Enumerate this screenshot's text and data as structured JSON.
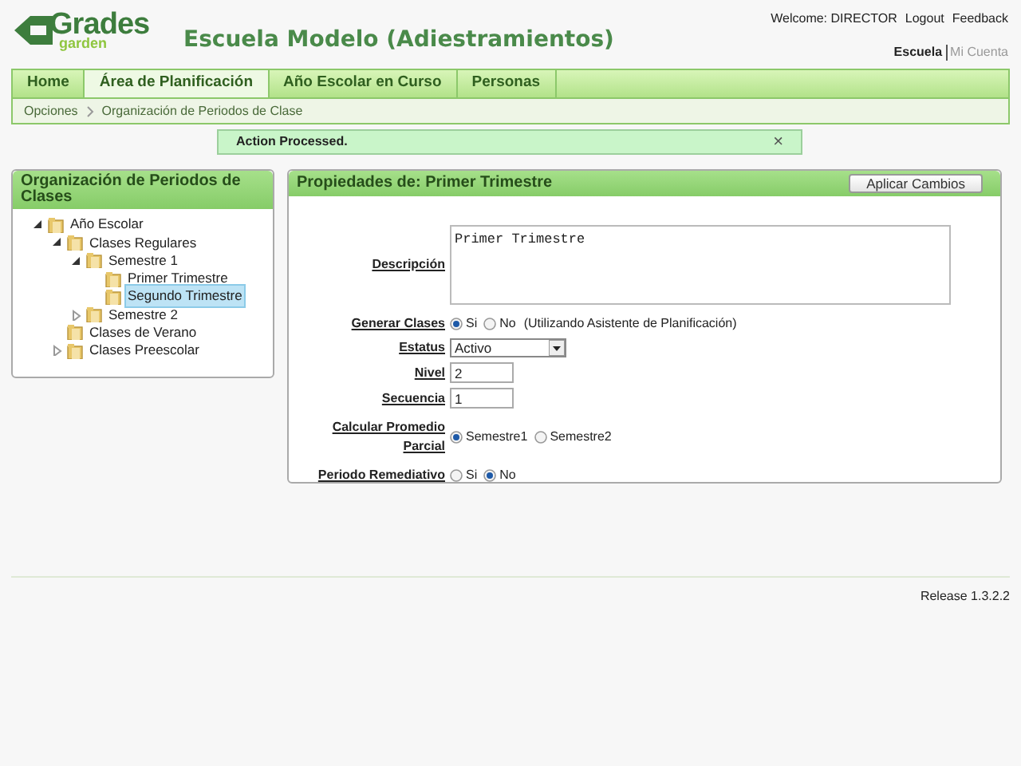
{
  "logo": {
    "line1": "Grades",
    "line2": "garden"
  },
  "school_title": "Escuela Modelo (Adiestramientos)",
  "user_bar": {
    "welcome": "Welcome: DIRECTOR",
    "links": [
      "Logout",
      "Feedback"
    ]
  },
  "context_links": [
    {
      "label": "Escuela",
      "selected": true
    },
    {
      "label": "Mi Cuenta",
      "selected": false
    }
  ],
  "tabs": [
    {
      "label": "Home",
      "selected": false
    },
    {
      "label": "Área de Planificación",
      "selected": true
    },
    {
      "label": "Año Escolar en Curso",
      "selected": false
    },
    {
      "label": "Personas",
      "selected": false
    }
  ],
  "breadcrumb": [
    "Opciones",
    "Organización de Periodos de Clase"
  ],
  "message": {
    "text": "Action Processed.",
    "close": "×"
  },
  "tree_panel": {
    "title": "Organización de Periodos de Clases",
    "items": [
      {
        "label": "Año Escolar",
        "expanded": true,
        "selected": false,
        "children": [
          {
            "label": "Clases Regulares",
            "expanded": true,
            "selected": false,
            "children": [
              {
                "label": "Semestre 1",
                "expanded": true,
                "selected": false,
                "children": [
                  {
                    "label": "Primer Trimestre",
                    "selected": false
                  },
                  {
                    "label": "Segundo Trimestre",
                    "selected": true
                  }
                ]
              },
              {
                "label": "Semestre 2",
                "expanded": false,
                "selected": false
              }
            ]
          },
          {
            "label": "Clases de Verano",
            "selected": false
          },
          {
            "label": "Clases Preescolar",
            "expanded": false,
            "selected": false
          }
        ]
      }
    ]
  },
  "properties_panel": {
    "title": "Propiedades de: Primer Trimestre",
    "apply_button": "Aplicar Cambios",
    "fields": [
      {
        "kind": "textarea",
        "label": "Descripción",
        "value": "Primer Trimestre"
      },
      {
        "kind": "radio",
        "label": "Generar Clases",
        "options": [
          {
            "label": "Si",
            "selected": true
          },
          {
            "label": "No",
            "selected": false
          }
        ],
        "note": "(Utilizando Asistente de Planificación)"
      },
      {
        "kind": "select",
        "label": "Estatus",
        "value": "Activo"
      },
      {
        "kind": "text",
        "label": "Nivel",
        "value": "2"
      },
      {
        "kind": "text",
        "label": "Secuencia",
        "value": "1"
      },
      {
        "kind": "radio",
        "label": "Calcular Promedio Parcial",
        "options": [
          {
            "label": "Semestre1",
            "selected": true
          },
          {
            "label": "Semestre2",
            "selected": false
          }
        ]
      },
      {
        "kind": "radio",
        "label": "Periodo Remediativo",
        "options": [
          {
            "label": "Si",
            "selected": false
          },
          {
            "label": "No",
            "selected": true
          }
        ]
      }
    ]
  },
  "footer": {
    "release": "Release 1.3.2.2"
  }
}
